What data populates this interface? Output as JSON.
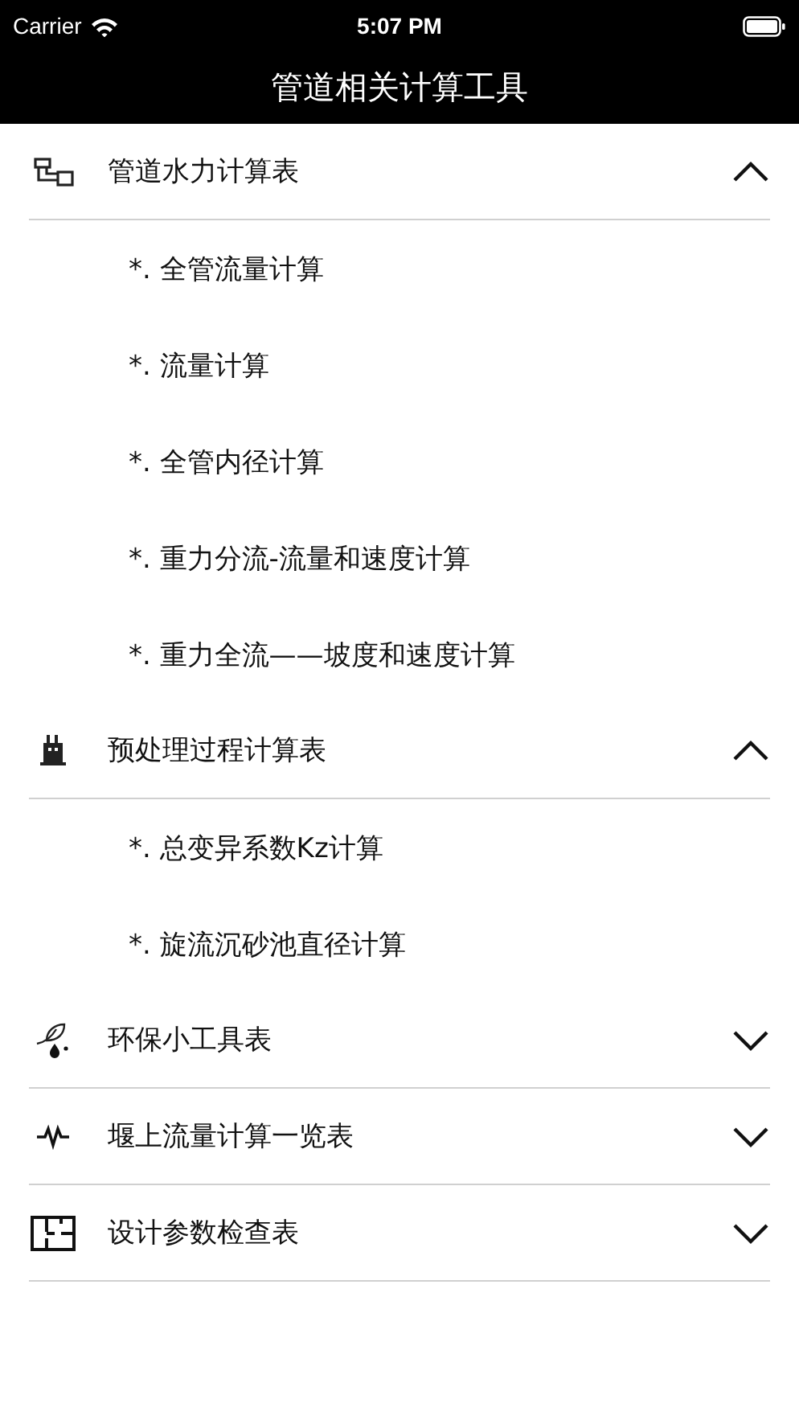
{
  "status_bar": {
    "carrier": "Carrier",
    "time": "5:07 PM"
  },
  "nav_bar": {
    "title": "管道相关计算工具"
  },
  "sections": [
    {
      "title": "管道水力计算表",
      "expanded": true,
      "items": [
        "*. 全管流量计算",
        "*. 流量计算",
        "*. 全管内径计算",
        "*. 重力分流-流量和速度计算",
        "*. 重力全流——坡度和速度计算"
      ]
    },
    {
      "title": "预处理过程计算表",
      "expanded": true,
      "items": [
        "*. 总变异系数Kz计算",
        "*. 旋流沉砂池直径计算"
      ]
    },
    {
      "title": "环保小工具表",
      "expanded": false
    },
    {
      "title": "堰上流量计算一览表",
      "expanded": false
    },
    {
      "title": "设计参数检查表",
      "expanded": false
    }
  ]
}
